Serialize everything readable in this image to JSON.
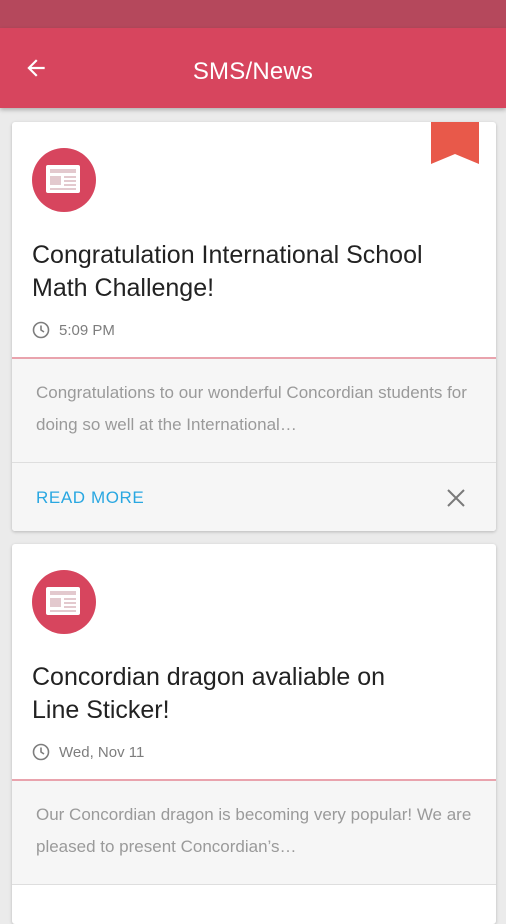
{
  "app_bar": {
    "title": "SMS/News",
    "back_icon": "arrow-back-icon"
  },
  "colors": {
    "status_bar": "#b5485c",
    "app_bar": "#d7455e",
    "accent_link": "#29a7e1",
    "bookmark": "#e8594a"
  },
  "news": [
    {
      "title": "Congratulation International School Math Challenge!",
      "time": "5:09 PM",
      "excerpt": "Congratulations to our wonderful Concordian students for doing so well at the International…",
      "read_more": "READ MORE",
      "bookmarked": true
    },
    {
      "title": "Concordian dragon avaliable on Line Sticker!",
      "time": "Wed, Nov 11",
      "excerpt": "Our Concordian dragon is becoming very popular! We are pleased to present Concordian’s…",
      "bookmarked": false
    }
  ]
}
